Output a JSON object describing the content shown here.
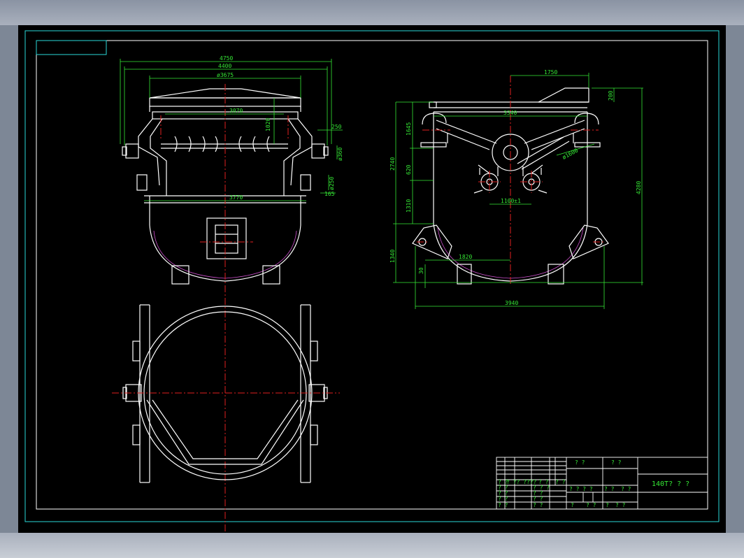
{
  "dimensions": {
    "front": {
      "w4750": "4750",
      "w4400": "4400",
      "d3675": "ø3675",
      "w3070": "3070",
      "h1020": "1020",
      "w3770": "3770",
      "s250": "250",
      "d360": "ø360",
      "d250": "ø250",
      "s165": "165"
    },
    "side": {
      "w1750": "1750",
      "w3340": "3340",
      "h200": "200",
      "h2740": "2740",
      "h1645": "1645",
      "h620": "620",
      "h1310": "1310",
      "h1340": "1340",
      "h30": "30",
      "d1600": "ø1600",
      "w1100": "1100±1",
      "w1820": "1820",
      "w3940": "3940",
      "h4280": "4280"
    }
  },
  "title_block": {
    "c1": "? ?",
    "c2": "? ?",
    "drawing_name": "140T? ? ?",
    "r1a": "? ?",
    "r1b": "? ??  ???? ",
    "r1c": "? ?",
    "r1d": "? ?",
    "r2a": "? ?",
    "r2b": "? ? ?",
    "r2c": "? ? ? ?",
    "r2d": "? ?",
    "r2e": "? ?",
    "r3a": "? ?",
    "r3b": "? ?",
    "r4a": "? ?",
    "r4b": "? ?",
    "r5a": "? ?",
    "r5b": "? ?",
    "r5c": "?",
    "r5d": "? ?",
    "r5e": "?",
    "r5f": "? ?"
  }
}
